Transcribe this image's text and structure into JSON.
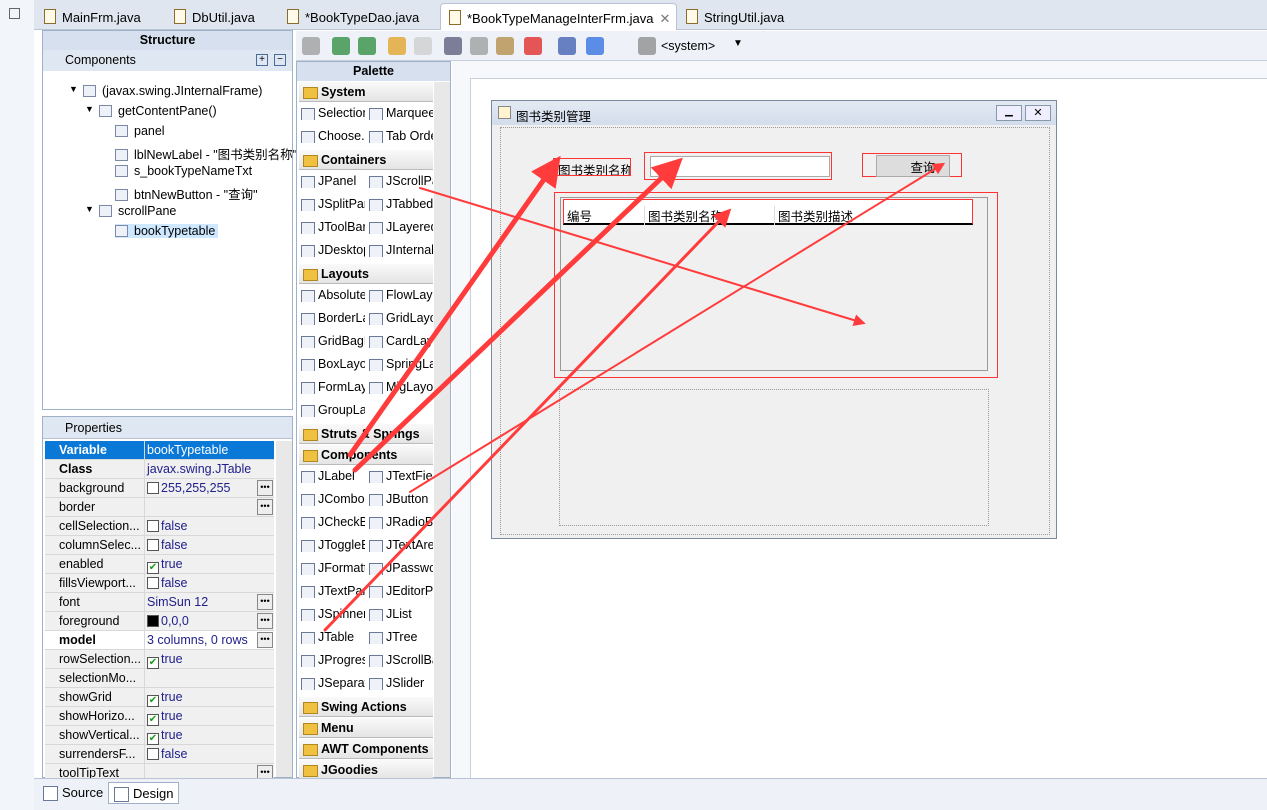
{
  "tabs": [
    {
      "label": "MainFrm.java"
    },
    {
      "label": "DbUtil.java"
    },
    {
      "label": "*BookTypeDao.java"
    },
    {
      "label": "*BookTypeManageInterFrm.java",
      "active": true
    },
    {
      "label": "StringUtil.java"
    }
  ],
  "structure": {
    "title": "Structure",
    "components_label": "Components",
    "tree": [
      "(javax.swing.JInternalFrame)",
      "getContentPane()",
      "panel",
      "lblNewLabel - \"图书类别名称\"",
      "s_bookTypeNameTxt",
      "btnNewButton - \"查询\"",
      "scrollPane",
      "bookTypetable"
    ]
  },
  "properties": {
    "title": "Properties",
    "rows": [
      {
        "k": "Variable",
        "v": "bookTypetable",
        "bold": true,
        "sel": true
      },
      {
        "k": "Class",
        "v": "javax.swing.JTable",
        "bold": true
      },
      {
        "k": "background",
        "v": "255,255,255",
        "swatch": "#ffffff",
        "dots": true
      },
      {
        "k": "border",
        "v": "",
        "dots": true
      },
      {
        "k": "cellSelection...",
        "v": "false",
        "cb": false
      },
      {
        "k": "columnSelec...",
        "v": "false",
        "cb": false
      },
      {
        "k": "enabled",
        "v": "true",
        "cb": true
      },
      {
        "k": "fillsViewport...",
        "v": "false",
        "cb": false
      },
      {
        "k": "font",
        "v": "SimSun 12",
        "dots": true
      },
      {
        "k": "foreground",
        "v": "0,0,0",
        "swatch": "#000000",
        "dots": true
      },
      {
        "k": "model",
        "v": "3 columns, 0 rows",
        "bold": true,
        "dots": true,
        "white": true
      },
      {
        "k": "rowSelection...",
        "v": "true",
        "cb": true
      },
      {
        "k": "selectionMo...",
        "v": ""
      },
      {
        "k": "showGrid",
        "v": "true",
        "cb": true
      },
      {
        "k": "showHorizo...",
        "v": "true",
        "cb": true
      },
      {
        "k": "showVertical...",
        "v": "true",
        "cb": true
      },
      {
        "k": "surrendersF...",
        "v": "false",
        "cb": false
      },
      {
        "k": "toolTipText",
        "v": "",
        "dots": true
      }
    ]
  },
  "toolbar": {
    "system_label": "<system>"
  },
  "palette": {
    "title": "Palette",
    "sections": [
      {
        "cat": "System",
        "items": [
          "Selection",
          "Marquee",
          "Choose...",
          "Tab Order"
        ]
      },
      {
        "cat": "Containers",
        "items": [
          "JPanel",
          "JScrollPane",
          "JSplitPane",
          "JTabbedPane",
          "JToolBar",
          "JLayeredPane",
          "JDesktopPane",
          "JInternalFrame"
        ]
      },
      {
        "cat": "Layouts",
        "items": [
          "Absolute",
          "FlowLayout",
          "BorderLayout",
          "GridLayout",
          "GridBagLayout",
          "CardLayout",
          "BoxLayout",
          "SpringLayout",
          "FormLayout",
          "MigLayout",
          "GroupLayout"
        ]
      },
      {
        "cat": "Struts & Springs",
        "items": []
      },
      {
        "cat": "Components",
        "items": [
          "JLabel",
          "JTextField",
          "JComboBox",
          "JButton",
          "JCheckBox",
          "JRadioButton",
          "JToggleButton",
          "JTextArea",
          "JFormattedTextField",
          "JPasswordField",
          "JTextPane",
          "JEditorPane",
          "JSpinner",
          "JList",
          "JTable",
          "JTree",
          "JProgressBar",
          "JScrollBar",
          "JSeparator",
          "JSlider"
        ]
      },
      {
        "cat": "Swing Actions",
        "items": []
      },
      {
        "cat": "Menu",
        "items": []
      },
      {
        "cat": "AWT Components",
        "items": []
      },
      {
        "cat": "JGoodies",
        "items": []
      }
    ]
  },
  "frame": {
    "title": "图书类别管理",
    "label": "图书类别名称",
    "text_value": "",
    "button": "查询",
    "columns": [
      "编号",
      "图书类别名称",
      "图书类别描述"
    ]
  },
  "bottom_tabs": [
    "Source",
    "Design"
  ],
  "colors": {
    "annotation": "#ff3b3b",
    "selection": "#0a78d7"
  }
}
